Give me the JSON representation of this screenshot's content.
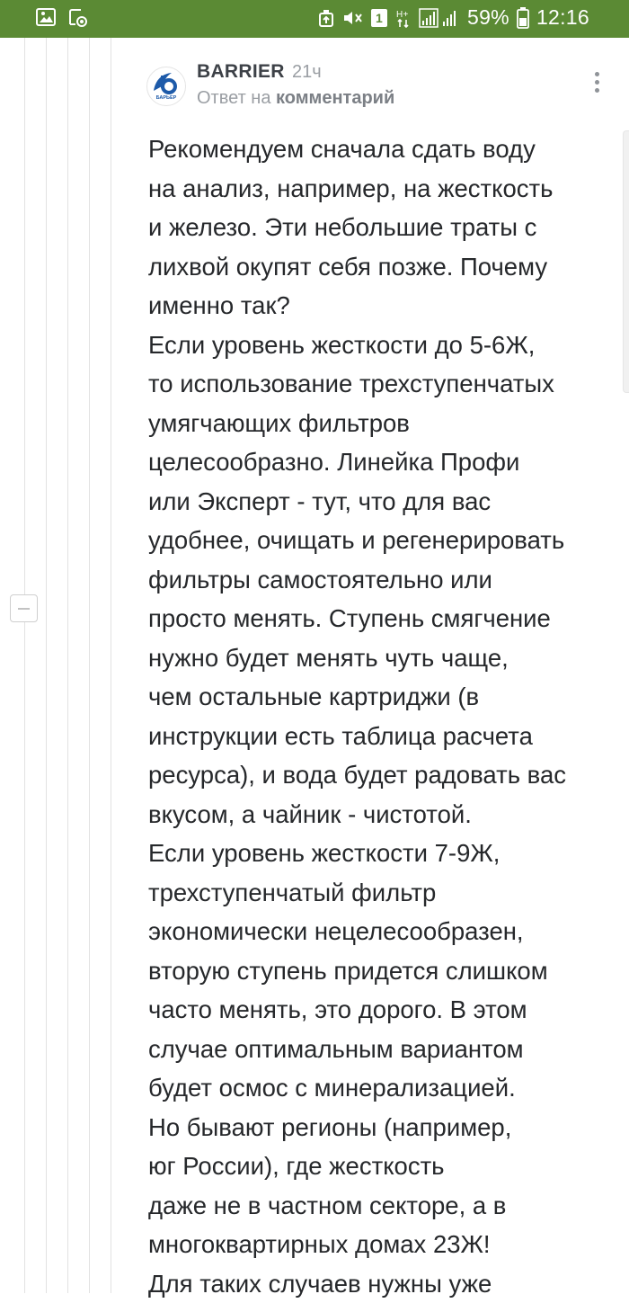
{
  "status_bar": {
    "battery_percent": "59%",
    "time": "12:16",
    "sim_badge": "1",
    "network_type": "H+",
    "color": "#5b8a34"
  },
  "comment": {
    "author": "BARRIER",
    "age": "21ч",
    "reply_prefix": "Ответ на",
    "reply_target": "комментарий",
    "avatar_text": "БАРЬЕР",
    "lines": [
      "Рекомендуем сначала сдать воду",
      "на анализ, например, на жесткость",
      "и железо. Эти небольшие траты с",
      "лихвой окупят себя позже. Почему",
      "именно так?",
      "Если уровень жесткости до 5-6Ж,",
      "то использование трехступенчатых",
      "умягчающих фильтров",
      "целесообразно. Линейка Профи",
      "или Эксперт - тут, что для вас",
      "удобнее, очищать и регенерировать",
      "фильтры самостоятельно или",
      "просто менять. Ступень смягчение",
      "нужно будет менять чуть чаще,",
      "чем остальные картриджи (в",
      "инструкции есть таблица расчета",
      "ресурса), и вода будет радовать вас",
      "вкусом, а чайник - чистотой.",
      "Если уровень жесткости 7-9Ж,",
      "трехступенчатый фильтр",
      "экономически нецелесообразен,",
      "вторую ступень придется слишком",
      "часто менять, это дорого. В этом",
      "случае оптимальным вариантом",
      "будет осмос с минерализацией.",
      "Но бывают регионы (например,",
      "юг России), где жесткость",
      "даже не в частном секторе, а в",
      "многоквартирных домах 23Ж!",
      "Для таких случаев нужны уже"
    ]
  },
  "icons": {
    "status_left": [
      "gallery-icon",
      "screenshot-icon"
    ],
    "status_right": [
      "data-saver-icon",
      "mute-icon",
      "sim-icon",
      "network-icon",
      "signal-icon",
      "battery-icon"
    ],
    "comment": [
      "avatar-logo",
      "more-menu-icon",
      "collapse-thread-icon"
    ]
  }
}
